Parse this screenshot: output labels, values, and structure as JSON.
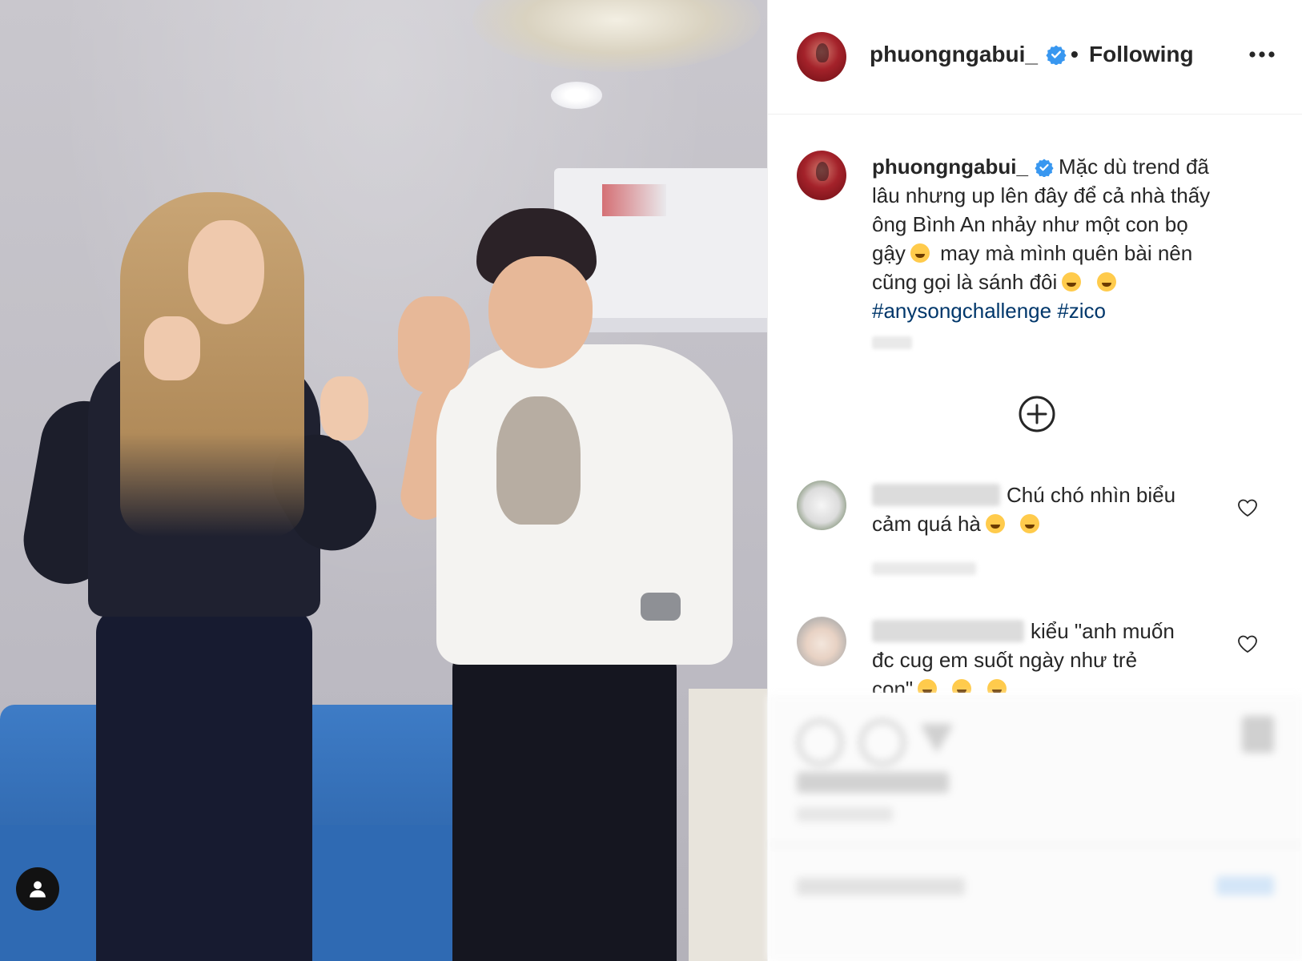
{
  "post": {
    "username": "phuongngabui_",
    "separator": "•",
    "follow_status": "Following",
    "caption": {
      "username": "phuongngabui_",
      "line1": "Mặc dù trend đã",
      "line2": "lâu nhưng up lên đây để cả nhà thấy",
      "line3": "ông Bình An nhảy như một con bọ",
      "line4a": "gậy",
      "line4b": "may mà mình quên bài nên",
      "line5": "cũng gọi là sánh đôi",
      "hashtag1": "#anysongchallenge",
      "hashtag2": "#zico"
    }
  },
  "comments": [
    {
      "line1": "Chú chó nhìn biểu",
      "line2": "cảm quá hà"
    },
    {
      "line1": "kiểu \"anh muốn",
      "line2": "đc cug em suốt ngày như trẻ",
      "line3": "con\""
    }
  ],
  "icons": {
    "verified": "verified-badge-icon",
    "more": "more-options-icon",
    "load_more": "plus-circle-icon",
    "like": "heart-icon",
    "tagged_user": "user-tag-icon"
  },
  "colors": {
    "verified": "#3897f0",
    "hashtag": "#00376b",
    "text": "#262626",
    "divider": "#efefef"
  }
}
